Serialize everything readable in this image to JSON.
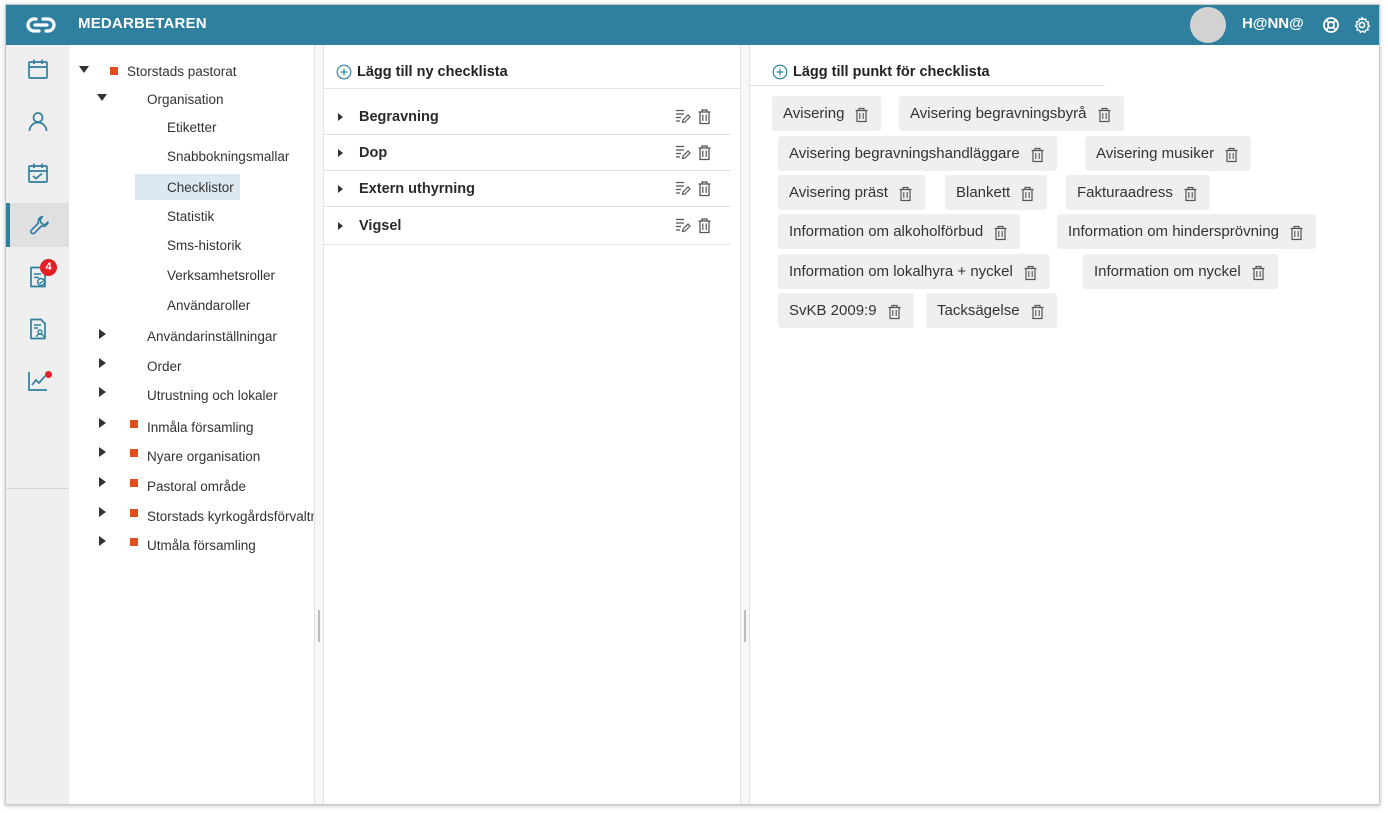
{
  "header": {
    "app_title": "MEDARBETAREN",
    "user_name": "H@NN@",
    "icons": [
      "app-logo-icon",
      "help-lifebuoy-icon",
      "settings-gear-icon"
    ],
    "colors": {
      "header_bg": "#2f7f9f",
      "accent_square": "#e04e1b",
      "badge": "#e31e24",
      "selected_bg": "#dce9f2"
    }
  },
  "rail": {
    "items": [
      {
        "icon": "calendar-icon"
      },
      {
        "icon": "person-icon"
      },
      {
        "icon": "calendar-check-icon"
      },
      {
        "icon": "wrench-icon",
        "active": true
      },
      {
        "icon": "document-check-icon",
        "badge": "4"
      },
      {
        "icon": "document-person-icon"
      },
      {
        "icon": "chart-line-icon",
        "dot": true
      }
    ]
  },
  "tree": {
    "root": "Storstads pastorat",
    "organisation": "Organisation",
    "org_children": [
      "Etiketter",
      "Snabbokningsmallar",
      "Checklistor",
      "Statistik",
      "Sms-historik",
      "Verksamhetsroller",
      "Användaroller"
    ],
    "sections": [
      "Användarinställningar",
      "Order",
      "Utrustning och lokaler"
    ],
    "units": [
      "Inmåla församling",
      "Nyare organisation",
      "Pastoral område",
      "Storstads kyrkogårdsförvaltning",
      "Utmåla församling"
    ],
    "selected": "Checklistor"
  },
  "checklists": {
    "add_label": "Lägg till ny checklista",
    "rows": [
      "Begravning",
      "Dop",
      "Extern uthyrning",
      "Vigsel"
    ]
  },
  "items": {
    "add_label": "Lägg till punkt för checklista",
    "chips": [
      "Avisering",
      "Avisering begravningsbyrå",
      "Avisering begravningshandläggare",
      "Avisering musiker",
      "Avisering präst",
      "Blankett",
      "Fakturaadress",
      "Information om alkoholförbud",
      "Information om hindersprövning",
      "Information om lokalhyra + nyckel",
      "Information om nyckel",
      "SvKB 2009:9",
      "Tacksägelse"
    ]
  }
}
